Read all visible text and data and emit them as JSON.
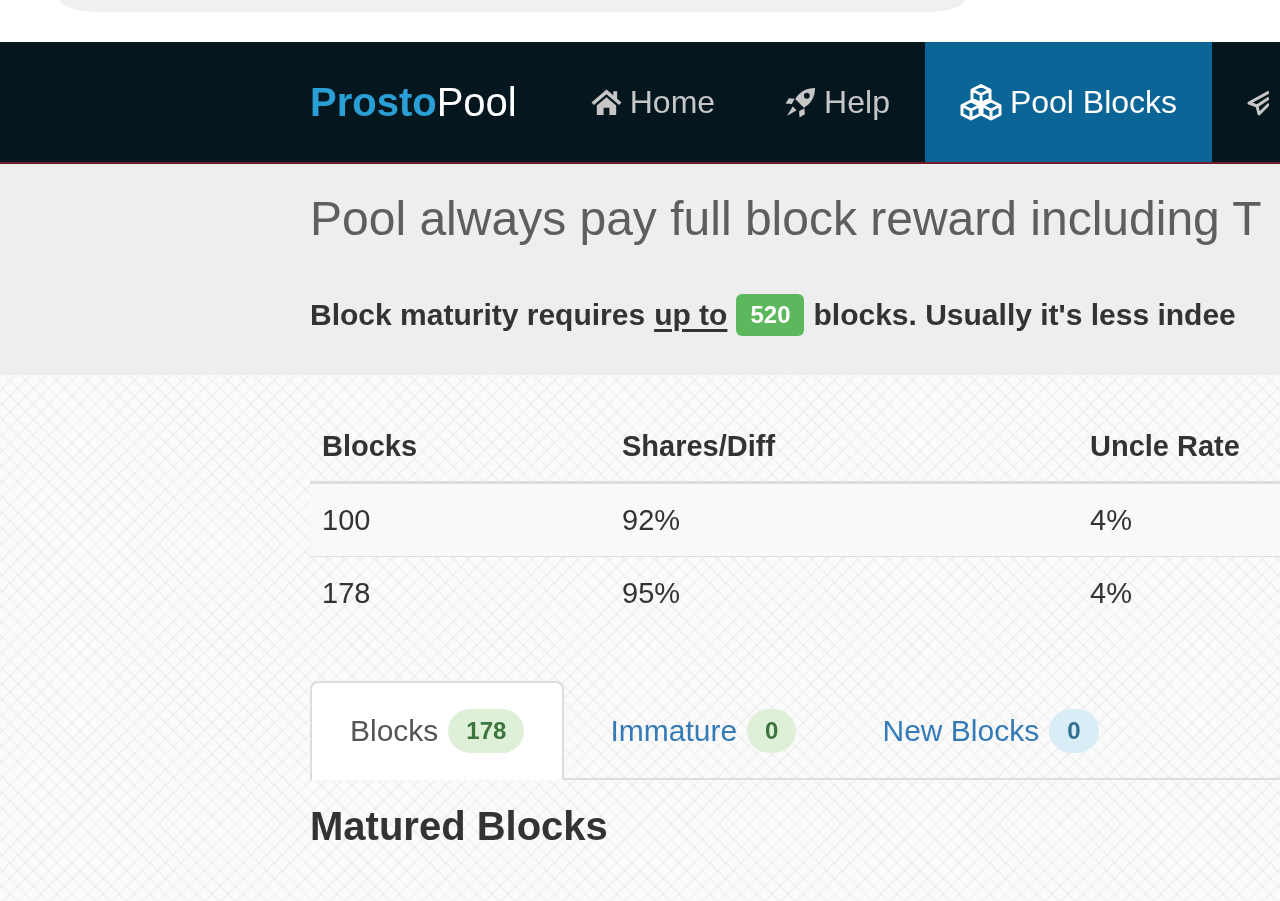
{
  "navbar": {
    "brand": "**Prosto**Pool",
    "items": [
      {
        "label": "Home",
        "selected": false
      },
      {
        "label": "Help",
        "selected": false
      },
      {
        "label": "Pool Blocks",
        "selected": true
      },
      {
        "selected": false
      }
    ]
  },
  "jumbotron": {
    "heading": "Pool always pay full block reward including T",
    "notice": {
      "text_before": "Block maturity requires",
      "underlined": "up to",
      "badge": "520",
      "text_after": "blocks. Usually it's less indee"
    }
  },
  "stats_table": {
    "columns": [
      "Blocks",
      "Shares/Diff",
      "Uncle Rate"
    ],
    "rows": [
      [
        "100",
        "92%",
        "4%"
      ],
      [
        "178",
        "95%",
        "4%"
      ]
    ]
  },
  "tabs": [
    {
      "label": "Blocks",
      "selected": true,
      "badge": {
        "text": "178",
        "kind": "success"
      }
    },
    {
      "label": "Immature",
      "selected": false,
      "badge": {
        "text": "0",
        "kind": "success"
      }
    },
    {
      "label": "New Blocks",
      "selected": false,
      "badge": {
        "text": "0",
        "kind": "info"
      }
    }
  ],
  "section": {
    "heading": "Matured Blocks"
  }
}
